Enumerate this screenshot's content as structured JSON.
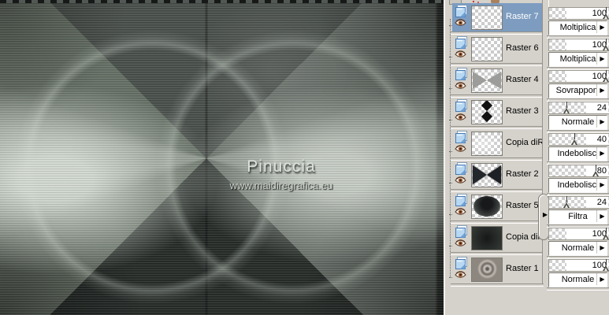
{
  "canvas": {
    "title": "Pinuccia",
    "subtitle": "www.maidiregrafica.eu"
  },
  "palette": {
    "layers": [
      {
        "name": "Raster 7",
        "opacity": 100,
        "blend": "Moltiplica",
        "thumb": "transparent",
        "selected": true
      },
      {
        "name": "Raster 6",
        "opacity": 100,
        "blend": "Moltiplica",
        "thumb": "transparent",
        "selected": false
      },
      {
        "name": "Raster 4",
        "opacity": 100,
        "blend": "Sovrapponi",
        "thumb": "bowtie-gray",
        "selected": false
      },
      {
        "name": "Raster 3",
        "opacity": 24,
        "blend": "Normale",
        "thumb": "diamonds",
        "selected": false
      },
      {
        "name": "Copia diRa",
        "opacity": 40,
        "blend": "Indebolisci",
        "thumb": "faint",
        "selected": false
      },
      {
        "name": "Raster 2",
        "opacity": 80,
        "blend": "Indebolisci",
        "thumb": "bowtie-dark",
        "selected": false
      },
      {
        "name": "Raster 5",
        "opacity": 24,
        "blend": "Filtra",
        "thumb": "ellipse-dark",
        "selected": false
      },
      {
        "name": "Copia diRa",
        "opacity": 100,
        "blend": "Normale",
        "thumb": "dark",
        "selected": false
      },
      {
        "name": "Raster 1",
        "opacity": 100,
        "blend": "Normale",
        "thumb": "spiral",
        "selected": false
      }
    ]
  },
  "colors": {
    "selection_blue": "#7d9cc0",
    "panel_gray": "#d5d2cb",
    "canvas_base": "#454a47"
  }
}
